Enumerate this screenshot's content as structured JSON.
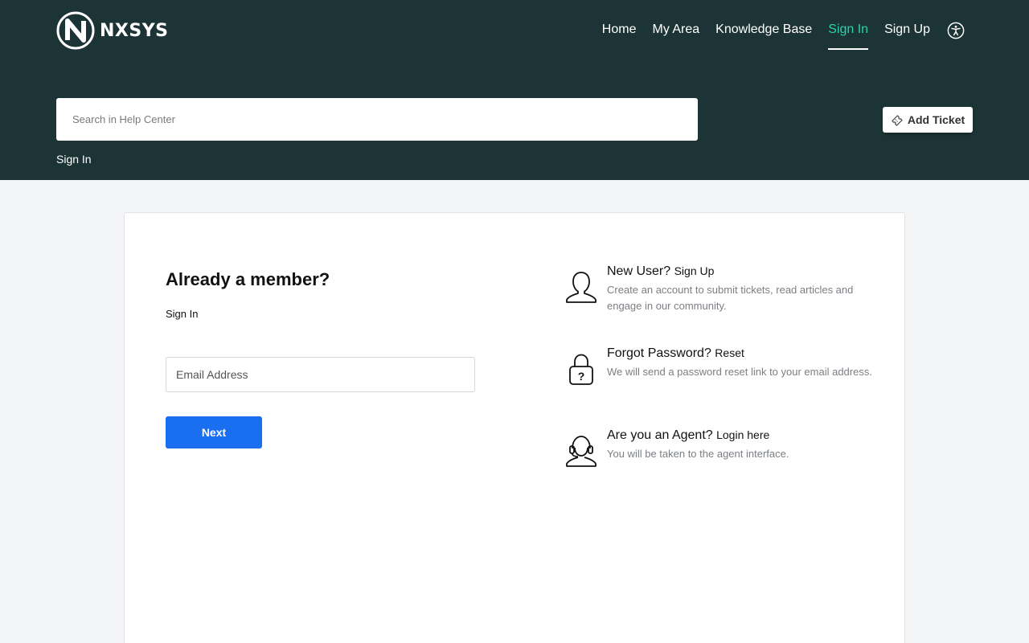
{
  "brand": {
    "name": "NXSYS"
  },
  "nav": {
    "items": [
      {
        "label": "Home",
        "active": false
      },
      {
        "label": "My Area",
        "active": false
      },
      {
        "label": "Knowledge Base",
        "active": false
      },
      {
        "label": "Sign In",
        "active": true
      },
      {
        "label": "Sign Up",
        "active": false
      }
    ],
    "accessibility_icon": "accessibility-icon"
  },
  "search": {
    "placeholder": "Search in Help Center",
    "value": ""
  },
  "add_ticket": {
    "label": "Add Ticket",
    "icon": "ticket-icon"
  },
  "breadcrumb": {
    "label": "Sign In"
  },
  "login": {
    "title": "Already a member?",
    "subtitle": "Sign In",
    "email_placeholder": "Email Address",
    "next_label": "Next"
  },
  "options": {
    "new_user": {
      "heading": "New User?",
      "link": "Sign Up",
      "description": "Create an account to submit tickets, read articles and engage in our community.",
      "icon": "user-icon"
    },
    "forgot": {
      "heading": "Forgot Password?",
      "link": "Reset",
      "description": "We will send a password reset link to your email address.",
      "icon": "lock-question-icon"
    },
    "agent": {
      "heading": "Are you an Agent?",
      "link": "Login here",
      "description": "You will be taken to the agent interface.",
      "icon": "headset-agent-icon"
    }
  },
  "colors": {
    "header_bg": "#1d3436",
    "active_nav": "#2bd3a8",
    "primary_button": "#1a6ef0",
    "page_bg": "#f3f5f7"
  }
}
